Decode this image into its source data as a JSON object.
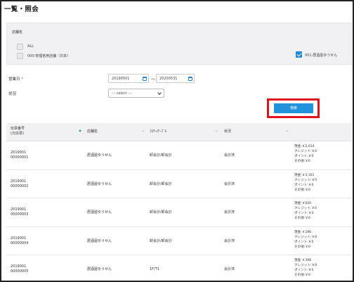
{
  "page": {
    "title": "一覧・照会"
  },
  "store_filter": {
    "label": "店舗名",
    "options": [
      {
        "label": "ALL",
        "checked": false
      },
      {
        "label": "000:管理者用店舗（日本）",
        "checked": false
      },
      {
        "label": "001:居酒屋ゆうせん",
        "checked": true
      }
    ]
  },
  "business_date": {
    "label": "営業日",
    "required_mark": "*",
    "from": "20190501",
    "separator": "～",
    "to": "20200531"
  },
  "status": {
    "label": "状況",
    "selected": "--- select ---"
  },
  "search_button": {
    "label": "検索"
  },
  "table": {
    "headers": {
      "slip_no": "伝票番号",
      "slip_no_sub": "(元伝票)",
      "store": "店舗名",
      "floor_table": "ﾌﾛｱｰ/ﾃｰﾌﾞﾙ",
      "status": "状況"
    },
    "rows": [
      {
        "slip_no": "2019001",
        "slip_sub": "00000001",
        "store": "居酒屋ゆうせん",
        "floor_table": "卸会計/卸会計",
        "status": "会計済",
        "cash": "現金:￥2,614",
        "credit": "クレジット:￥0",
        "points": "ポイント:￥0",
        "other": "その他:￥0"
      },
      {
        "slip_no": "2019001",
        "slip_sub": "00000002",
        "store": "居酒屋ゆうせん",
        "floor_table": "卸会計/卸会計",
        "status": "会計済",
        "cash": "現金:￥3,161",
        "credit": "クレジット:￥0",
        "points": "ポイント:￥0",
        "other": "その他:￥0"
      },
      {
        "slip_no": "2019001",
        "slip_sub": "00000003",
        "store": "居酒屋ゆうせん",
        "floor_table": "卸会計/卸会計",
        "status": "会計済",
        "cash": "現金:￥620",
        "credit": "クレジット:￥0",
        "points": "ポイント:￥0",
        "other": "その他:￥0"
      },
      {
        "slip_no": "2019001",
        "slip_sub": "00000004",
        "store": "居酒屋ゆうせん",
        "floor_table": "卸会計/卸会計",
        "status": "会計済",
        "cash": "現金:￥286",
        "credit": "クレジット:￥0",
        "points": "ポイント:￥0",
        "other": "その他:￥0"
      },
      {
        "slip_no": "2019001",
        "slip_sub": "00000005",
        "store": "居酒屋ゆうせん",
        "floor_table": "1F/T1",
        "status": "会計済",
        "cash": "現金:￥398",
        "credit": "クレジット:￥0",
        "points": "ポイント:￥0",
        "other": "その他:￥0"
      }
    ]
  },
  "colors": {
    "accent": "#2193dd",
    "highlight": "#e0121b",
    "panel_bg": "#f1f1f3"
  }
}
